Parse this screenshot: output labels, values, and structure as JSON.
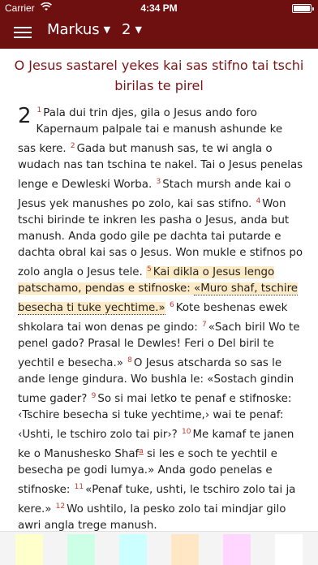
{
  "status_bar": {
    "carrier": "Carrier",
    "time": "4:34 PM"
  },
  "nav": {
    "book": "Markus",
    "chapter": "2"
  },
  "colors": {
    "header": "#6e0f10",
    "heading_text": "#7a1416",
    "verse_number": "#c0392b",
    "highlight": "#fdebc8"
  },
  "section_heading": "O Jesus sastarel yekes kai sas stifno tai tschi birilas te pirel",
  "chapter_number": "2",
  "verses": [
    {
      "n": "1",
      "t": "Pala dui trin djes, gila o Jesus ando foro Kapernaum palpale tai e manush ashunde ke sas kere. "
    },
    {
      "n": "2",
      "t": "Gada but manush sas, te wi angla o wudach nas tan tschina te nakel. Tai o Jesus penelas lenge e Dewleski Worba. "
    },
    {
      "n": "3",
      "t": "Stach mursh ande kai o Jesus yek manushes po zolo, kai sas stifno. "
    },
    {
      "n": "4",
      "t": "Won tschi birinde te inkren les pasha o Jesus, anda but manush. Anda godo gile pe dachta tai putarde e dachta obral kai sas o Jesus. Won mukle e stifnos po zolo angla o Jesus tele. "
    },
    {
      "n": "5",
      "t_a": "Kai dikla o Jesus lengo patschamo, pendas e stifnoske: ",
      "t_b": "«Muro shaf, tschire besecha ti tuke yechtime.»",
      "t_c": " "
    },
    {
      "n": "6",
      "t": "Kote beshenas ewek shkolara tai won denas pe gindo: "
    },
    {
      "n": "7",
      "t": "«Sach biril Wo te penel gado? Prasal le Dewles! Feri o Del biril te yechtil e besecha.» "
    },
    {
      "n": "8",
      "t": "O Jesus atscharda so sas le ande lenge gindura. Wo bushla le: «Sostach gindin tume gader? "
    },
    {
      "n": "9",
      "t": "So si mai letko te penaf e stifnoske: ‹Tschire besecha si tuke yechtime,› wai te penaf: ‹Ushti, le tschiro zolo tai pir›? "
    },
    {
      "n": "10",
      "t_a": "Me kamaf te janen ke o Manushesko Shaf",
      "fn": "a",
      "t_b": " si les e soch te yechtil e besecha pe godi lumya.» Anda godo penelas e stifnoske: "
    },
    {
      "n": "11",
      "t": "«Penaf tuke, ushti, le tschiro zolo tai ja kere.» "
    },
    {
      "n": "12",
      "t": "Wo ushtilo, la pesko zolo tai mindjar gilo awri angla trege manush."
    }
  ],
  "highlight_colors": [
    "#ffffcc",
    "#ccffe6",
    "#ccffff",
    "#ffe6c4",
    "#ffd6ff",
    "#ffffff"
  ]
}
